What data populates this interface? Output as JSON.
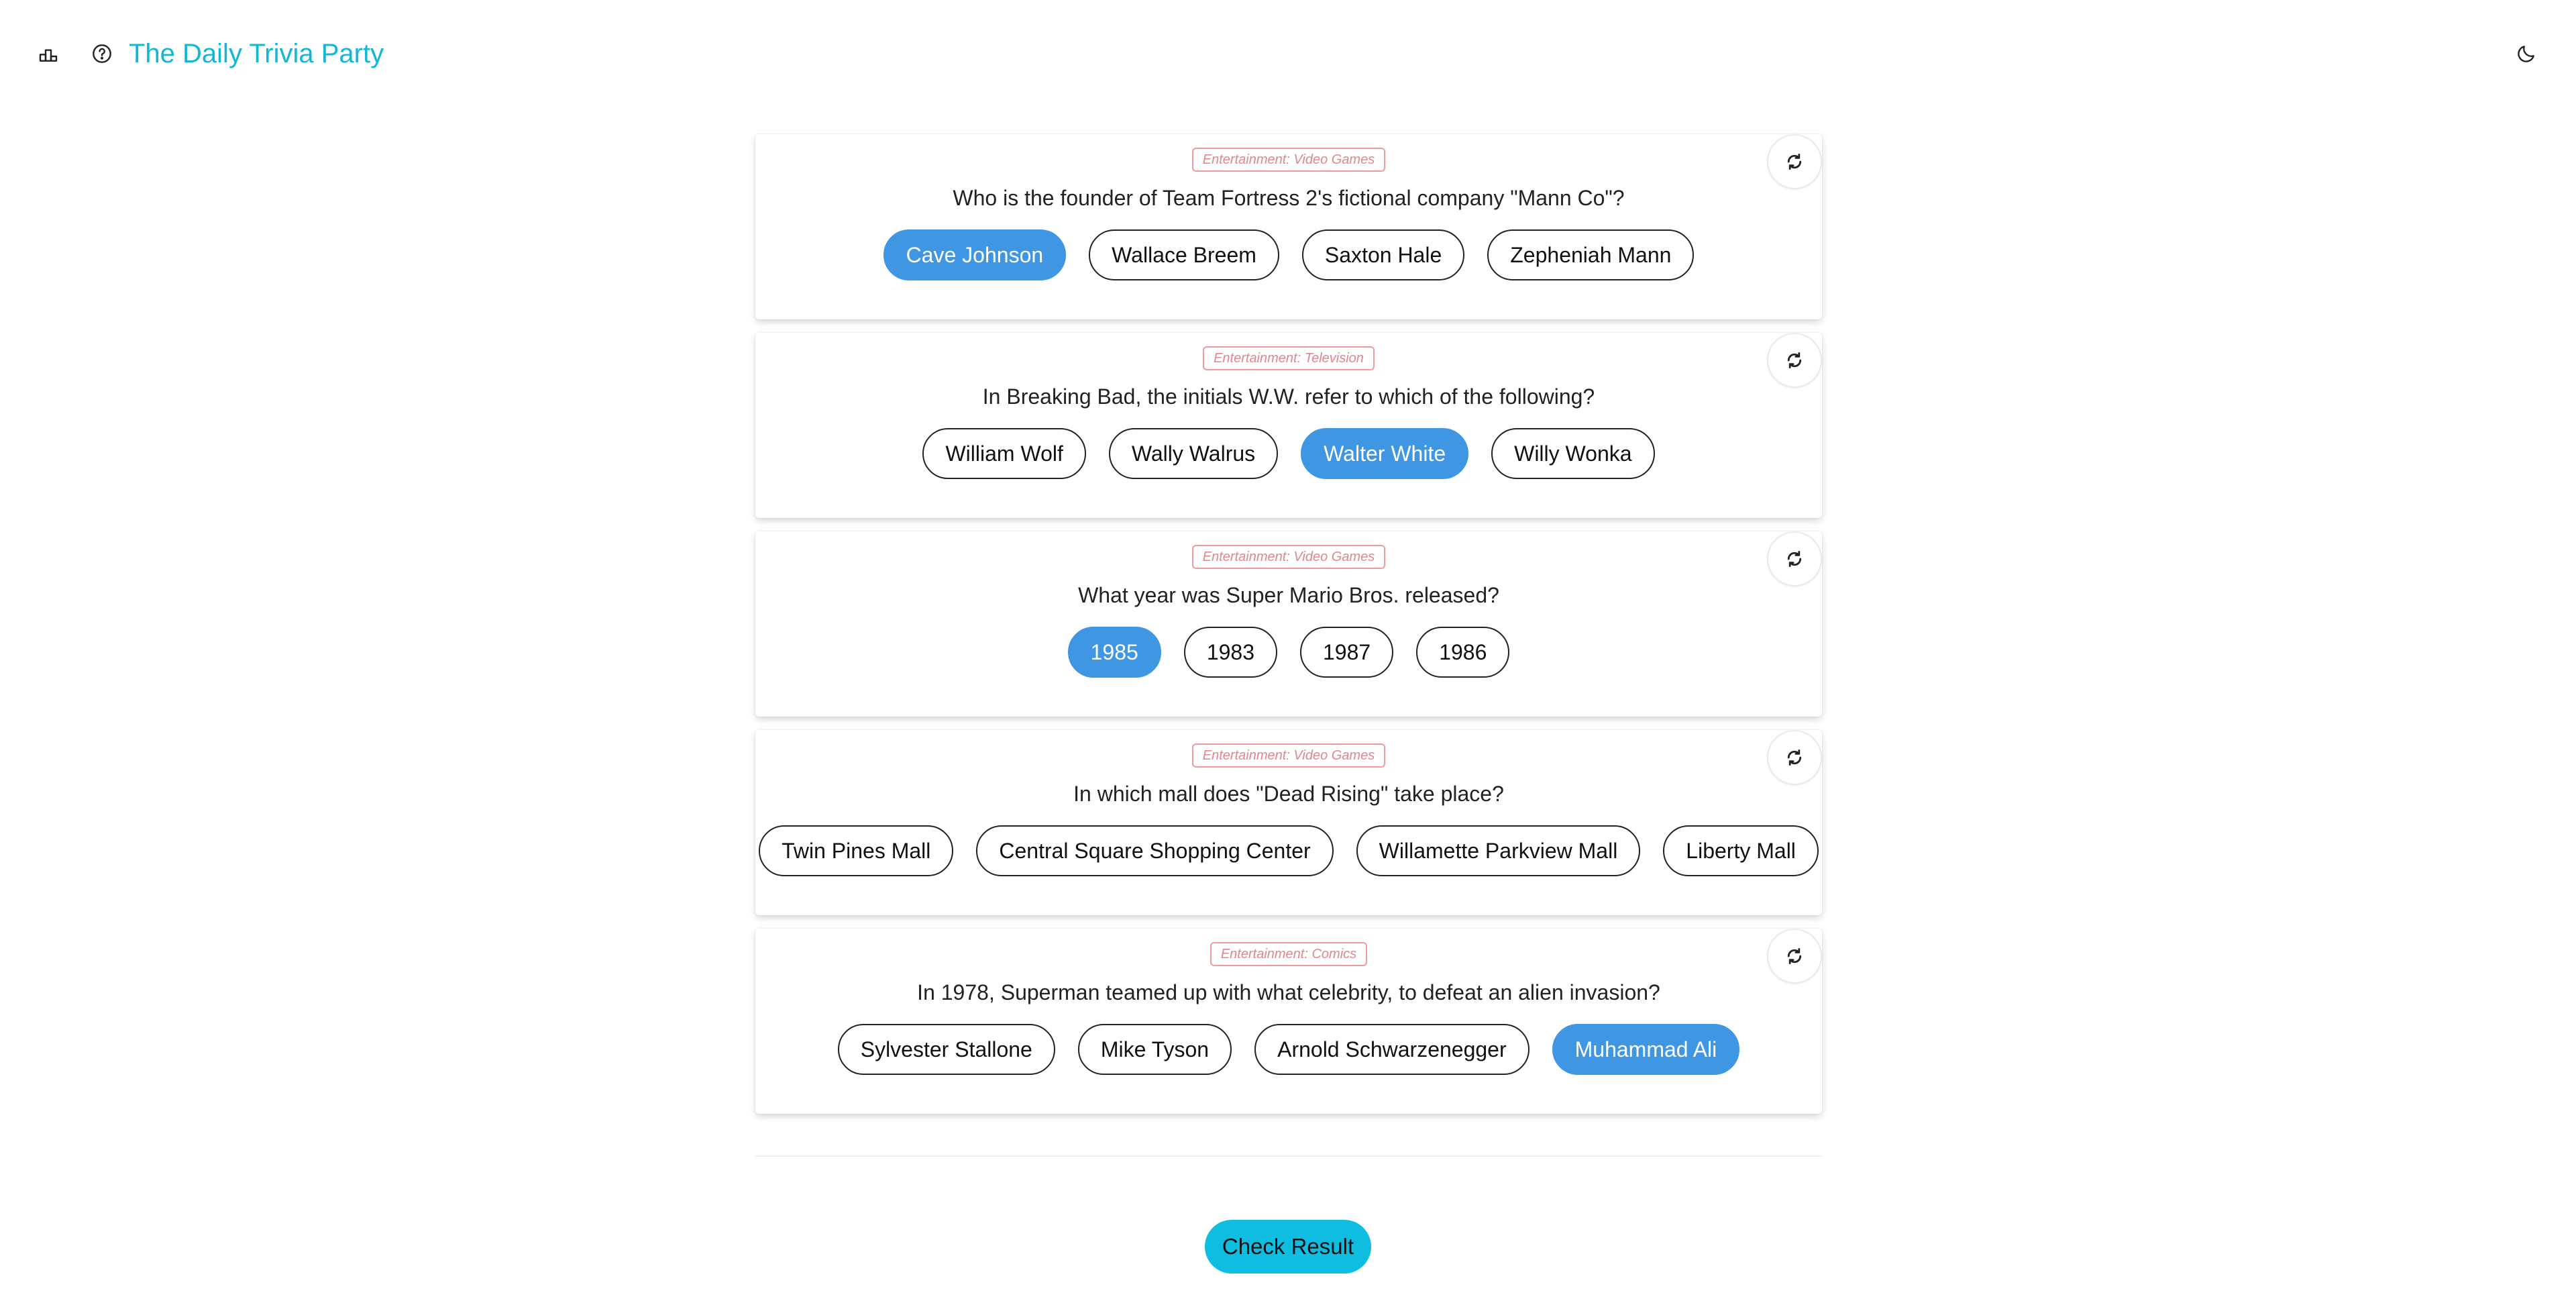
{
  "header": {
    "title": "The Daily Trivia Party",
    "icons": [
      "podium-icon",
      "help-icon",
      "moon-icon"
    ]
  },
  "colors": {
    "accent": "#0fb8d6",
    "selected": "#3f97e3",
    "category": "#e0868e",
    "check_button": "#0fbde0"
  },
  "questions": [
    {
      "category": "Entertainment: Video Games",
      "question": "Who is the founder of Team Fortress 2's fictional company \"Mann Co\"?",
      "answers": [
        "Cave Johnson",
        "Wallace Breem",
        "Saxton Hale",
        "Zepheniah Mann"
      ],
      "selected": 0
    },
    {
      "category": "Entertainment: Television",
      "question": "In Breaking Bad, the initials W.W. refer to which of the following?",
      "answers": [
        "William Wolf",
        "Wally Walrus",
        "Walter White",
        "Willy Wonka"
      ],
      "selected": 2
    },
    {
      "category": "Entertainment: Video Games",
      "question": "What year was Super Mario Bros. released?",
      "answers": [
        "1985",
        "1983",
        "1987",
        "1986"
      ],
      "selected": 0
    },
    {
      "category": "Entertainment: Video Games",
      "question": "In which mall does \"Dead Rising\" take place?",
      "answers": [
        "Twin Pines Mall",
        "Central Square Shopping Center",
        "Willamette Parkview Mall",
        "Liberty Mall"
      ],
      "selected": -1
    },
    {
      "category": "Entertainment: Comics",
      "question": "In 1978, Superman teamed up with what celebrity, to defeat an alien invasion?",
      "answers": [
        "Sylvester Stallone",
        "Mike Tyson",
        "Arnold Schwarzenegger",
        "Muhammad Ali"
      ],
      "selected": 3
    }
  ],
  "check_button": {
    "label": "Check Result"
  }
}
